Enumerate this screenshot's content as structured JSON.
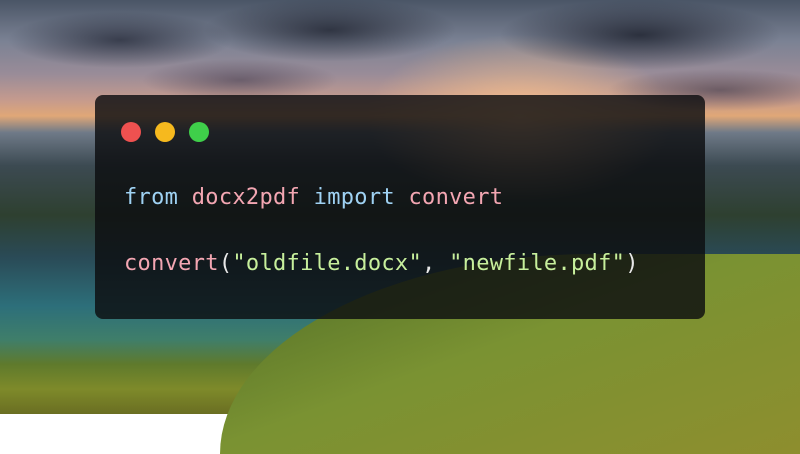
{
  "theme": {
    "keyword_color": "#9fd2f3",
    "name_color": "#f3a6b2",
    "string_color": "#c7ef9c",
    "window_bg": "#0c0e10"
  },
  "window": {
    "controls": [
      "close",
      "minimize",
      "maximize"
    ],
    "control_colors": [
      "#ef5150",
      "#f6b91e",
      "#3fcf4a"
    ]
  },
  "code": {
    "line1": {
      "kw_from": "from",
      "module": "docx2pdf",
      "kw_import": "import",
      "func": "convert"
    },
    "line2": {
      "func": "convert",
      "open_paren": "(",
      "arg1": "\"oldfile.docx\"",
      "comma": ", ",
      "arg2": "\"newfile.pdf\"",
      "close_paren": ")"
    }
  }
}
